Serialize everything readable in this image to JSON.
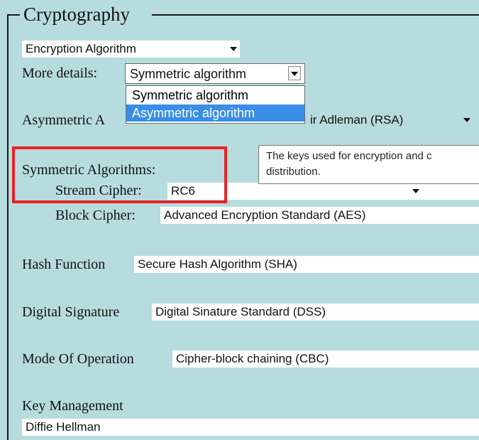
{
  "fieldset": {
    "legend": "Cryptography"
  },
  "top_select": {
    "value": "Encryption Algorithm"
  },
  "more_details": {
    "label": "More details:",
    "value": "Symmetric algorithm",
    "options": [
      "Symmetric algorithm",
      "Asymmetric algorithm"
    ],
    "highlighted_option": "Asymmetric algorithm"
  },
  "asymmetric": {
    "label": "Asymmetric A",
    "value_visible": "ir Adleman (RSA)"
  },
  "tooltip": {
    "line1": "The keys used for encryption and c",
    "line2": "distribution."
  },
  "symmetric": {
    "label": "Symmetric Algorithms:",
    "stream_label": "Stream Cipher:",
    "stream_value": "RC6",
    "block_label": "Block Cipher:",
    "block_value": "Advanced Encryption Standard (AES)"
  },
  "hash": {
    "label": "Hash Function",
    "value": "Secure Hash Algorithm (SHA)"
  },
  "signature": {
    "label": "Digital Signature",
    "value": "Digital Sinature Standard (DSS)"
  },
  "mode": {
    "label": "Mode Of Operation",
    "value": "Cipher-block chaining (CBC)"
  },
  "key_management": {
    "label": "Key Management",
    "value": "Diffie Hellman"
  },
  "colors": {
    "panel_background": "#b7dcdd",
    "highlight_box": "#e8232a",
    "selected_option": "#3a8ee6"
  }
}
